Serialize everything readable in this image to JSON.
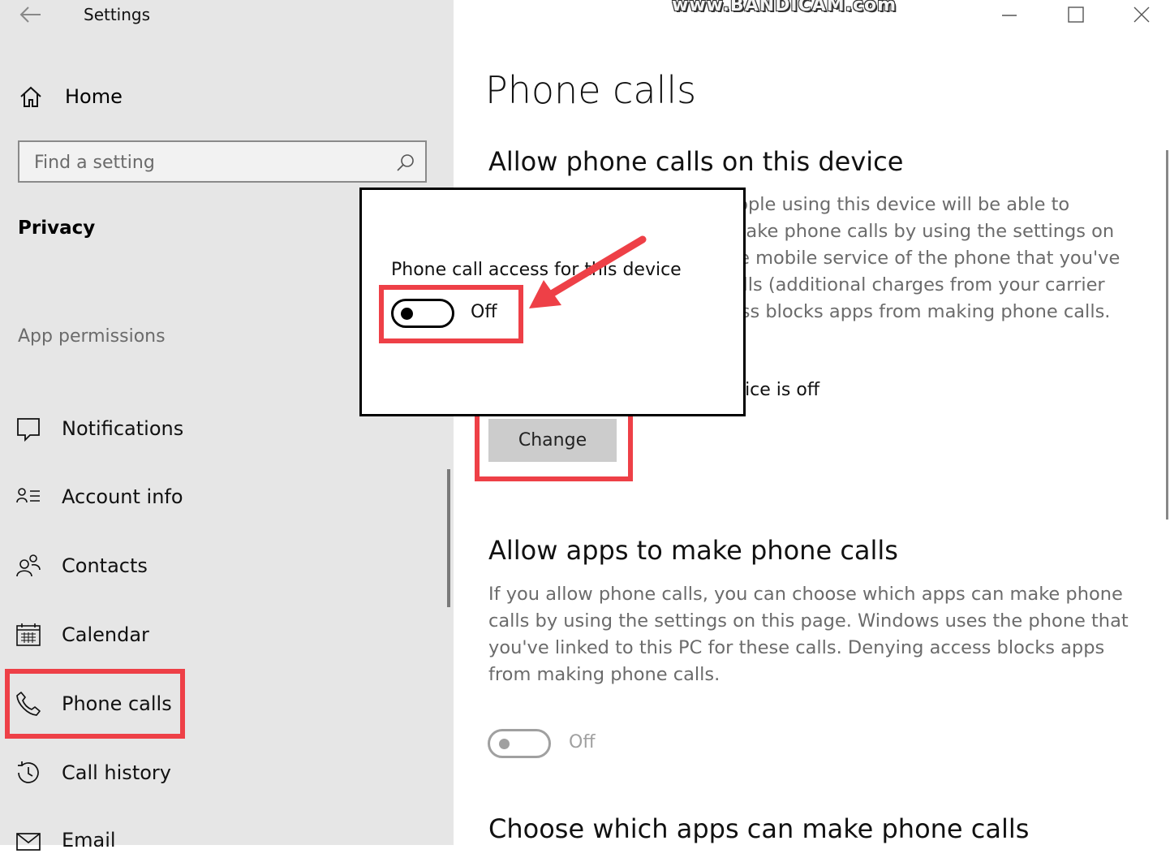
{
  "window": {
    "title": "Settings",
    "watermark": "www.BANDICAM.com"
  },
  "sidebar": {
    "home_label": "Home",
    "search_placeholder": "Find a setting",
    "section_title": "Privacy",
    "permissions_title": "App permissions",
    "items": [
      {
        "label": "Notifications",
        "icon": "notifications-icon"
      },
      {
        "label": "Account info",
        "icon": "account-info-icon"
      },
      {
        "label": "Contacts",
        "icon": "contacts-icon"
      },
      {
        "label": "Calendar",
        "icon": "calendar-icon"
      },
      {
        "label": "Phone calls",
        "icon": "phone-icon",
        "selected": true
      },
      {
        "label": "Call history",
        "icon": "history-icon"
      },
      {
        "label": "Email",
        "icon": "email-icon"
      }
    ]
  },
  "main": {
    "title": "Phone calls",
    "section1": {
      "heading": "Allow phone calls on this device",
      "description": "If you allow phone calls, people using this device will be able to choose whether apps can make phone calls by using the settings on this page. Windows uses the mobile service of the phone that you've linked to this PC to make calls (additional charges from your carrier might apply). Denying access blocks apps from making phone calls.",
      "status": "Phone call access for this device is off",
      "change_button": "Change"
    },
    "section2": {
      "heading": "Allow apps to make phone calls",
      "description": "If you allow phone calls, you can choose which apps can make phone calls by using the settings on this page. Windows uses the phone that you've linked to this PC for these calls. Denying access blocks apps from making phone calls.",
      "toggle_label": "Off",
      "toggle_on": false
    },
    "section3": {
      "heading": "Choose which apps can make phone calls"
    }
  },
  "popup": {
    "label": "Phone call access for this device",
    "toggle_label": "Off",
    "toggle_on": false
  },
  "colors": {
    "highlight": "#ee4047",
    "sidebar_bg": "#e6e6e6",
    "secondary_text": "#6b6b6b",
    "button_bg": "#cccccc"
  }
}
